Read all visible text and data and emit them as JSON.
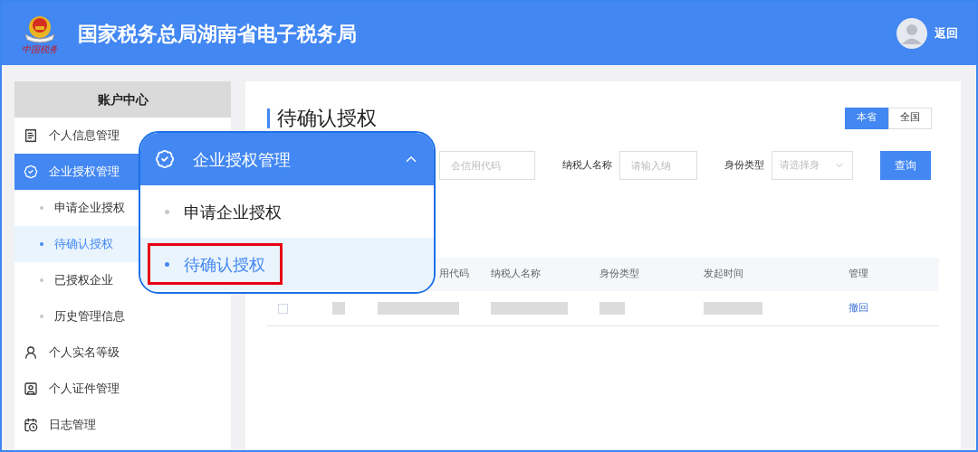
{
  "header": {
    "logo_text": "中国税务",
    "title": "国家税务总局湖南省电子税务局",
    "back": "返回"
  },
  "sidebar": {
    "title": "账户中心",
    "items": [
      {
        "label": "个人信息管理",
        "selected": false
      },
      {
        "label": "企业授权管理",
        "selected": true,
        "children": [
          {
            "label": "申请企业授权",
            "selected": false
          },
          {
            "label": "待确认授权",
            "selected": true
          },
          {
            "label": "已授权企业",
            "selected": false
          },
          {
            "label": "历史管理信息",
            "selected": false
          }
        ]
      },
      {
        "label": "个人实名等级",
        "selected": false
      },
      {
        "label": "个人证件管理",
        "selected": false
      },
      {
        "label": "日志管理",
        "selected": false
      }
    ]
  },
  "main": {
    "title": "待确认授权",
    "scope_tabs": [
      {
        "label": "本省",
        "selected": true
      },
      {
        "label": "全国",
        "selected": false
      }
    ],
    "filters": [
      {
        "kind": "input",
        "placeholder": "会信用代码"
      },
      {
        "kind": "input",
        "label": "纳税人名称",
        "placeholder": "请输入纳"
      },
      {
        "kind": "select",
        "label": "身份类型",
        "placeholder": "请选择身"
      }
    ],
    "search_button": "查询",
    "table": {
      "columns": [
        "",
        "",
        "用代码",
        "纳税人名称",
        "身份类型",
        "发起时间",
        "管理"
      ],
      "rows": [
        {
          "checked": false,
          "action": "撤回"
        }
      ]
    }
  },
  "callout": {
    "title": "企业授权管理",
    "expanded": true,
    "items": [
      {
        "label": "申请企业授权",
        "selected": false,
        "highlighted": false
      },
      {
        "label": "待确认授权",
        "selected": true,
        "highlighted": true
      }
    ]
  }
}
